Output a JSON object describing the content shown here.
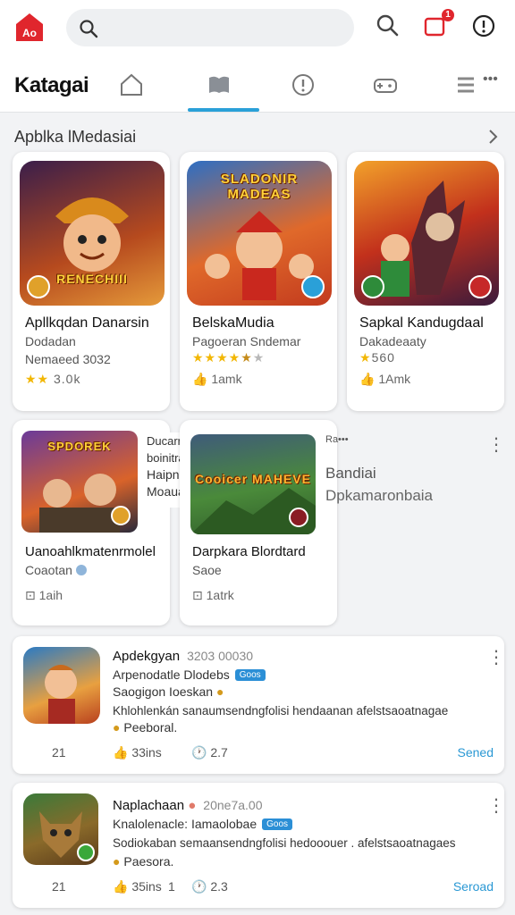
{
  "colors": {
    "accent": "#2aa0d8",
    "brand_red": "#e0262d",
    "star": "#f2b705",
    "link": "#2a98d4"
  },
  "topbar": {
    "logo_icon": "store-logo-icon",
    "search": {
      "placeholder": ""
    },
    "search_icon": "search-icon",
    "notifications_badge": "1",
    "icons": [
      "search-icon",
      "notification-box-icon",
      "info-circle-icon"
    ]
  },
  "nav": {
    "title": "Katagai",
    "tabs": [
      "home-icon",
      "book-icon",
      "alert-circle-icon",
      "gamepad-icon",
      "menu-icon"
    ],
    "more_label": "•••"
  },
  "section": {
    "title": "Apblka lMedasiai"
  },
  "featured": [
    {
      "thumb_text": "RENECHIII",
      "title": "Apllkqdan Danarsin",
      "sub1": "Dodadan",
      "sub2": "Nemaeed 3032",
      "rating_text": "3.0k",
      "stars_full": 2,
      "stars_half": 0,
      "stars_empty": 0
    },
    {
      "thumb_text": "SLADONIR MADEAS",
      "title": "BelskaMudia",
      "sub1": "Pagoeran Sndemar",
      "rating_text": "",
      "stars_full": 4,
      "stars_half": 1,
      "stars_empty": 1,
      "meta": "1amk"
    },
    {
      "thumb_text": "",
      "title": "Sapkal Kandugdaal",
      "sub1": "Dakadeaaty",
      "rating_text": "560",
      "stars_full": 1,
      "stars_half": 0,
      "stars_empty": 0,
      "meta": "1Amk"
    }
  ],
  "second_row": [
    {
      "thumb_text": "SPDOREK",
      "title": "Uanoahlkmatenrmolel",
      "sub1": "Coaotan",
      "meta": "1aih"
    },
    {
      "thumb_text": "Cooicer MAHEVE",
      "title": "Darpkara Blordtard",
      "sub1": "Saoe",
      "meta": "1atrk"
    }
  ],
  "overlay_label": {
    "line1": "Ducarrnaa",
    "line2": "boinitran",
    "line3": "Haipnare",
    "line4": "Moaua"
  },
  "side_text": {
    "small": "Ra•••",
    "line1": "Bandiai",
    "line2": "Dpkamaronbaia"
  },
  "list": [
    {
      "title": "Apdekgyan",
      "number": "3203 00030",
      "line1": "Arpenodatle Dlodebs",
      "chip": "Goos",
      "line2": "Saogigon Ioeskan",
      "desc": "Khlohlenkán sanaumsendngfolisi hendaanan afelstsaoatnagae",
      "desc2": "Peeboral.",
      "likes": "33ins",
      "comments": "2.7",
      "count": "21",
      "link": "Sened"
    },
    {
      "title": "Naplachaan",
      "number": "20ne7a.00",
      "line1": "Knalolenacle: Iamaolobae",
      "chip": "Goos",
      "line2": "",
      "desc": "Sodiokaban semaansendngfolisi hedooouer . afelstsaoatnagaes",
      "desc2": "Paesora.",
      "likes": "35ins",
      "comments": "2.3",
      "count": "21",
      "extra": "1",
      "link": "Seroad"
    }
  ]
}
